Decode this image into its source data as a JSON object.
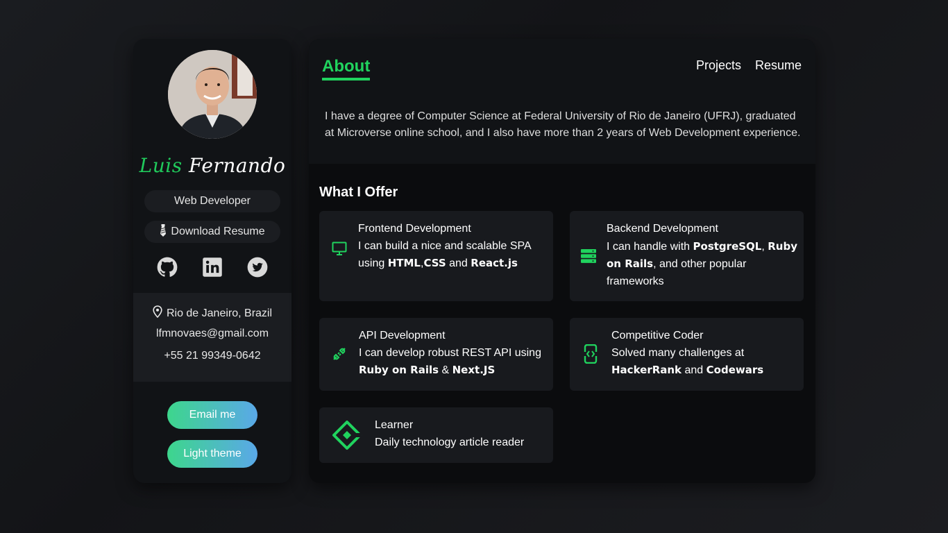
{
  "profile": {
    "first_name": "Luis",
    "last_name": "Fernando",
    "role": "Web Developer",
    "resume_link": "Download Resume",
    "location": "Rio de Janeiro, Brazil",
    "email": "lfmnovaes@gmail.com",
    "phone": "+55 21 99349-0642",
    "email_button": "Email me",
    "theme_button": "Light theme",
    "socials": [
      "github-icon",
      "linkedin-icon",
      "twitter-icon"
    ]
  },
  "nav": {
    "active": "About",
    "links": [
      "Projects",
      "Resume"
    ]
  },
  "about": {
    "text": "I have a degree of Computer Science at Federal University of Rio de Janeiro (UFRJ), graduated at Microverse online school, and I also have more than 2 years of Web Development experience."
  },
  "offer": {
    "title": "What I Offer",
    "cards": [
      {
        "icon": "monitor-icon",
        "title": "Frontend Development",
        "parts": [
          {
            "t": "I can build a nice and scalable SPA using "
          },
          {
            "t": "HTML",
            "b": true
          },
          {
            "t": ","
          },
          {
            "t": "CSS",
            "b": true
          },
          {
            "t": " and "
          },
          {
            "t": "React.js",
            "b": true
          }
        ]
      },
      {
        "icon": "server-icon",
        "title": "Backend Development",
        "parts": [
          {
            "t": "I can handle with "
          },
          {
            "t": "PostgreSQL",
            "b": true
          },
          {
            "t": ", "
          },
          {
            "t": "Ruby on Rails",
            "b": true
          },
          {
            "t": ", and other popular frameworks"
          }
        ]
      },
      {
        "icon": "api-plug-icon",
        "title": "API Development",
        "parts": [
          {
            "t": "I can develop robust REST API using "
          },
          {
            "t": "Ruby on Rails",
            "b": true
          },
          {
            "t": " & "
          },
          {
            "t": "Next.JS",
            "b": true
          }
        ]
      },
      {
        "icon": "code-brackets-icon",
        "title": "Competitive Coder",
        "parts": [
          {
            "t": "Solved many challenges at "
          },
          {
            "t": "HackerRank",
            "b": true
          },
          {
            "t": " and "
          },
          {
            "t": "Codewars",
            "b": true
          }
        ]
      },
      {
        "icon": "learner-diamond-icon",
        "title": "Learner",
        "parts": [
          {
            "t": "Daily technology article reader"
          }
        ]
      }
    ]
  },
  "colors": {
    "accent": "#20d35e",
    "card_bg": "#181a1e",
    "panel_bg": "#111316",
    "main_bg": "#0b0c0e",
    "gradient_start": "#3dd68c",
    "gradient_end": "#5aa8e8"
  }
}
